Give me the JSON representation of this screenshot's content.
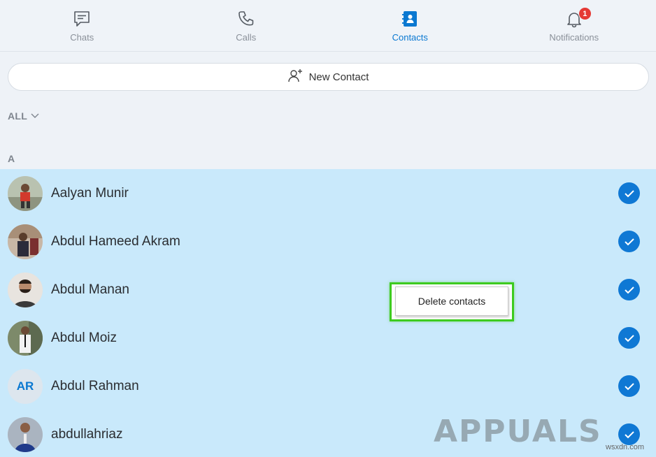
{
  "nav": {
    "tabs": [
      {
        "label": "Chats",
        "icon": "chat-icon",
        "active": false
      },
      {
        "label": "Calls",
        "icon": "phone-icon",
        "active": false
      },
      {
        "label": "Contacts",
        "icon": "contacts-book-icon",
        "active": true
      },
      {
        "label": "Notifications",
        "icon": "bell-icon",
        "active": false,
        "badge": "1"
      }
    ]
  },
  "new_contact": {
    "label": "New Contact",
    "icon": "add-person-icon"
  },
  "filter": {
    "label": "ALL",
    "icon": "chevron-down-icon"
  },
  "section": {
    "letter": "A"
  },
  "contacts": [
    {
      "name": "Aalyan Munir",
      "avatar": "photo",
      "selected": true
    },
    {
      "name": "Abdul Hameed Akram",
      "avatar": "photo",
      "selected": true
    },
    {
      "name": "Abdul Manan",
      "avatar": "photo",
      "selected": true
    },
    {
      "name": "Abdul Moiz",
      "avatar": "photo",
      "selected": true
    },
    {
      "name": "Abdul Rahman",
      "avatar": "initials",
      "initials": "AR",
      "selected": true
    },
    {
      "name": "abdullahriaz",
      "avatar": "photo",
      "selected": true
    }
  ],
  "context_menu": {
    "item": "Delete contacts"
  },
  "watermark": {
    "brand": "APPUALS",
    "site": "wsxdn.com"
  },
  "colors": {
    "accent": "#0a78d1",
    "selection": "#c9e9fb",
    "highlight": "#3dcb1f",
    "badge": "#e53935"
  }
}
